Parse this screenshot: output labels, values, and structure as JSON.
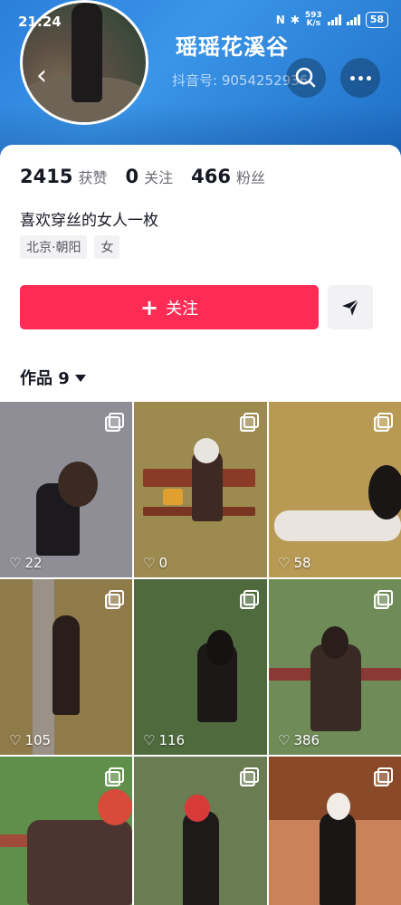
{
  "status": {
    "time": "21:24",
    "net_speed_value": "593",
    "net_speed_unit": "K/s",
    "battery": "58"
  },
  "profile": {
    "nickname": "瑶瑶花溪谷",
    "douyin_id": "抖音号: 9054252936",
    "stats": [
      {
        "value": "2415",
        "label": "获赞"
      },
      {
        "value": "0",
        "label": "关注"
      },
      {
        "value": "466",
        "label": "粉丝"
      }
    ],
    "bio": "喜欢穿丝的女人一枚",
    "tags": [
      "北京·朝阳",
      "女"
    ]
  },
  "actions": {
    "follow_label": "关注"
  },
  "works": {
    "tab_label": "作品 9",
    "items": [
      {
        "likes": "22",
        "bg": "#8f8e96"
      },
      {
        "likes": "0",
        "bg": "#9c8a4e"
      },
      {
        "likes": "58",
        "bg": "#b89a55"
      },
      {
        "likes": "105",
        "bg": "#8f7a4a"
      },
      {
        "likes": "116",
        "bg": "#4f6b3e"
      },
      {
        "likes": "386",
        "bg": "#6f8b58"
      },
      {
        "likes": "",
        "bg": "#5f8f4a"
      },
      {
        "likes": "",
        "bg": "#6a7c52"
      },
      {
        "likes": "",
        "bg": "#c9825a"
      }
    ]
  },
  "colors": {
    "accent": "#fe2c55",
    "header_blue": "#2b7fd9"
  }
}
